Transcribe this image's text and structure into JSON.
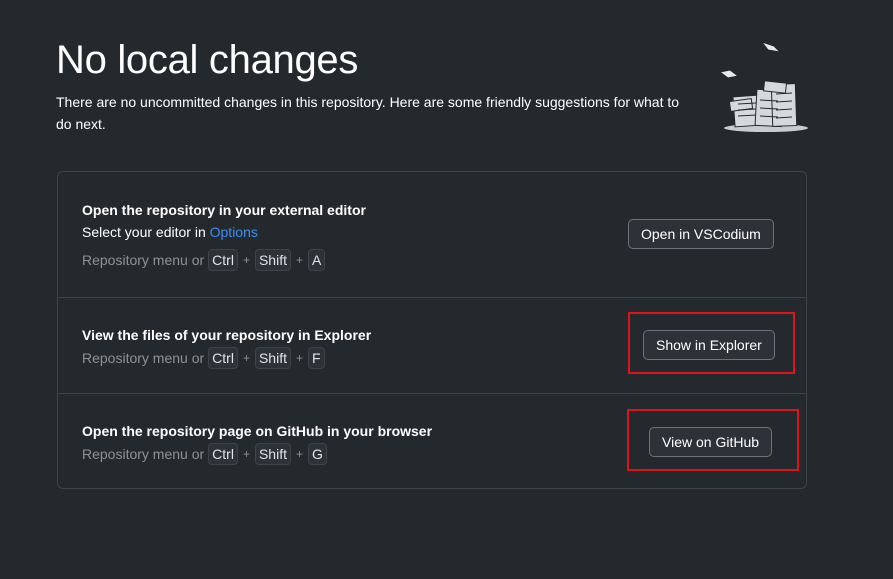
{
  "header": {
    "title": "No local changes",
    "subtitle": "There are no uncommitted changes in this repository. Here are some friendly suggestions for what to do next."
  },
  "suggestions": [
    {
      "heading": "Open the repository in your external editor",
      "description_prefix": "Select your editor in ",
      "description_link": "Options",
      "shortcut_prefix": "Repository menu or",
      "keys": [
        "Ctrl",
        "Shift",
        "A"
      ],
      "button_label": "Open in VSCodium"
    },
    {
      "heading": "View the files of your repository in Explorer",
      "shortcut_prefix": "Repository menu or",
      "keys": [
        "Ctrl",
        "Shift",
        "F"
      ],
      "button_label": "Show in Explorer"
    },
    {
      "heading": "Open the repository page on GitHub in your browser",
      "shortcut_prefix": "Repository menu or",
      "keys": [
        "Ctrl",
        "Shift",
        "G"
      ],
      "button_label": "View on GitHub"
    }
  ],
  "key_separator": "+",
  "illustration": "paper-stack-icon",
  "colors": {
    "background": "#24292e",
    "border": "#3f444a",
    "link": "#3a8ff7",
    "highlight": "#e0121a"
  }
}
